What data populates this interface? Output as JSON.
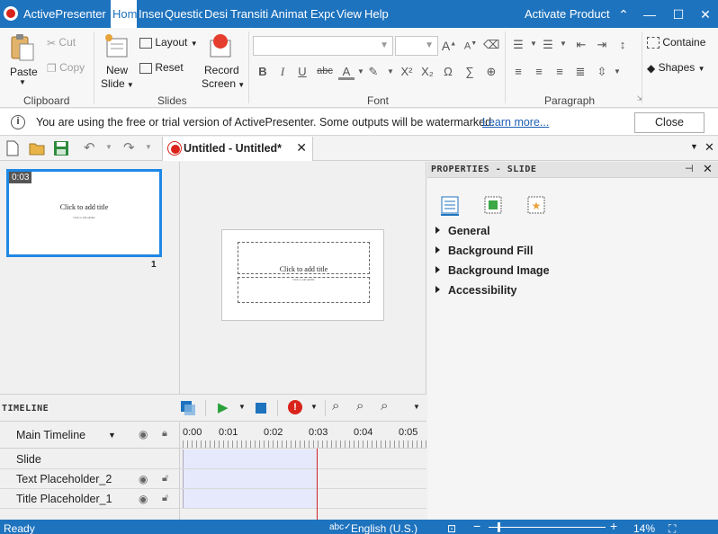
{
  "app": {
    "name": "ActivePresenter",
    "activate": "Activate Product"
  },
  "menu": [
    "Hom",
    "Inser",
    "Questic",
    "Desi",
    "Transiti",
    "Animat",
    "Expo",
    "View",
    "Help"
  ],
  "ribbon": {
    "clipboard": {
      "paste": "Paste",
      "cut": "Cut",
      "copy": "Copy",
      "label": "Clipboard"
    },
    "slides": {
      "new_slide_1": "New",
      "new_slide_2": "Slide",
      "layout": "Layout",
      "reset": "Reset",
      "record_1": "Record",
      "record_2": "Screen",
      "label": "Slides"
    },
    "font": {
      "label": "Font",
      "bold": "B",
      "italic": "I",
      "underline": "U",
      "strike": "abc",
      "grow": "A",
      "shrink": "A",
      "color": "A",
      "sup": "X²",
      "sub": "X₂",
      "omega": "Ω"
    },
    "paragraph": {
      "label": "Paragraph"
    },
    "insert": {
      "container": "Containe",
      "shapes": "Shapes"
    }
  },
  "notice": {
    "text": "You are using the free or trial version of ActivePresenter. Some outputs will be watermarked.",
    "learn_more": "Learn more...",
    "close": "Close"
  },
  "document": {
    "tab_title": "Untitled - Untitled*"
  },
  "slides_panel": {
    "thumb": {
      "duration": "0:03",
      "title": "Click to add title",
      "subtitle": "Click to add subtitle",
      "number": "1"
    }
  },
  "canvas": {
    "title_placeholder": "Click to add title",
    "subtitle_placeholder": "Click to add subtitle"
  },
  "properties": {
    "title": "PROPERTIES - SLIDE",
    "sections": [
      "General",
      "Background Fill",
      "Background Image",
      "Accessibility"
    ]
  },
  "timeline": {
    "title": "TIMELINE",
    "main": "Main Timeline",
    "ruler": [
      "0:00",
      "0:01",
      "0:02",
      "0:03",
      "0:04",
      "0:05"
    ],
    "rows": [
      "Slide",
      "Text Placeholder_2",
      "Title Placeholder_1"
    ]
  },
  "status": {
    "ready": "Ready",
    "language": "English (U.S.)",
    "zoom": "14%"
  },
  "colors": {
    "accent": "#1e73be",
    "playhead": "#d0202a",
    "track": "#e6e9fb"
  }
}
